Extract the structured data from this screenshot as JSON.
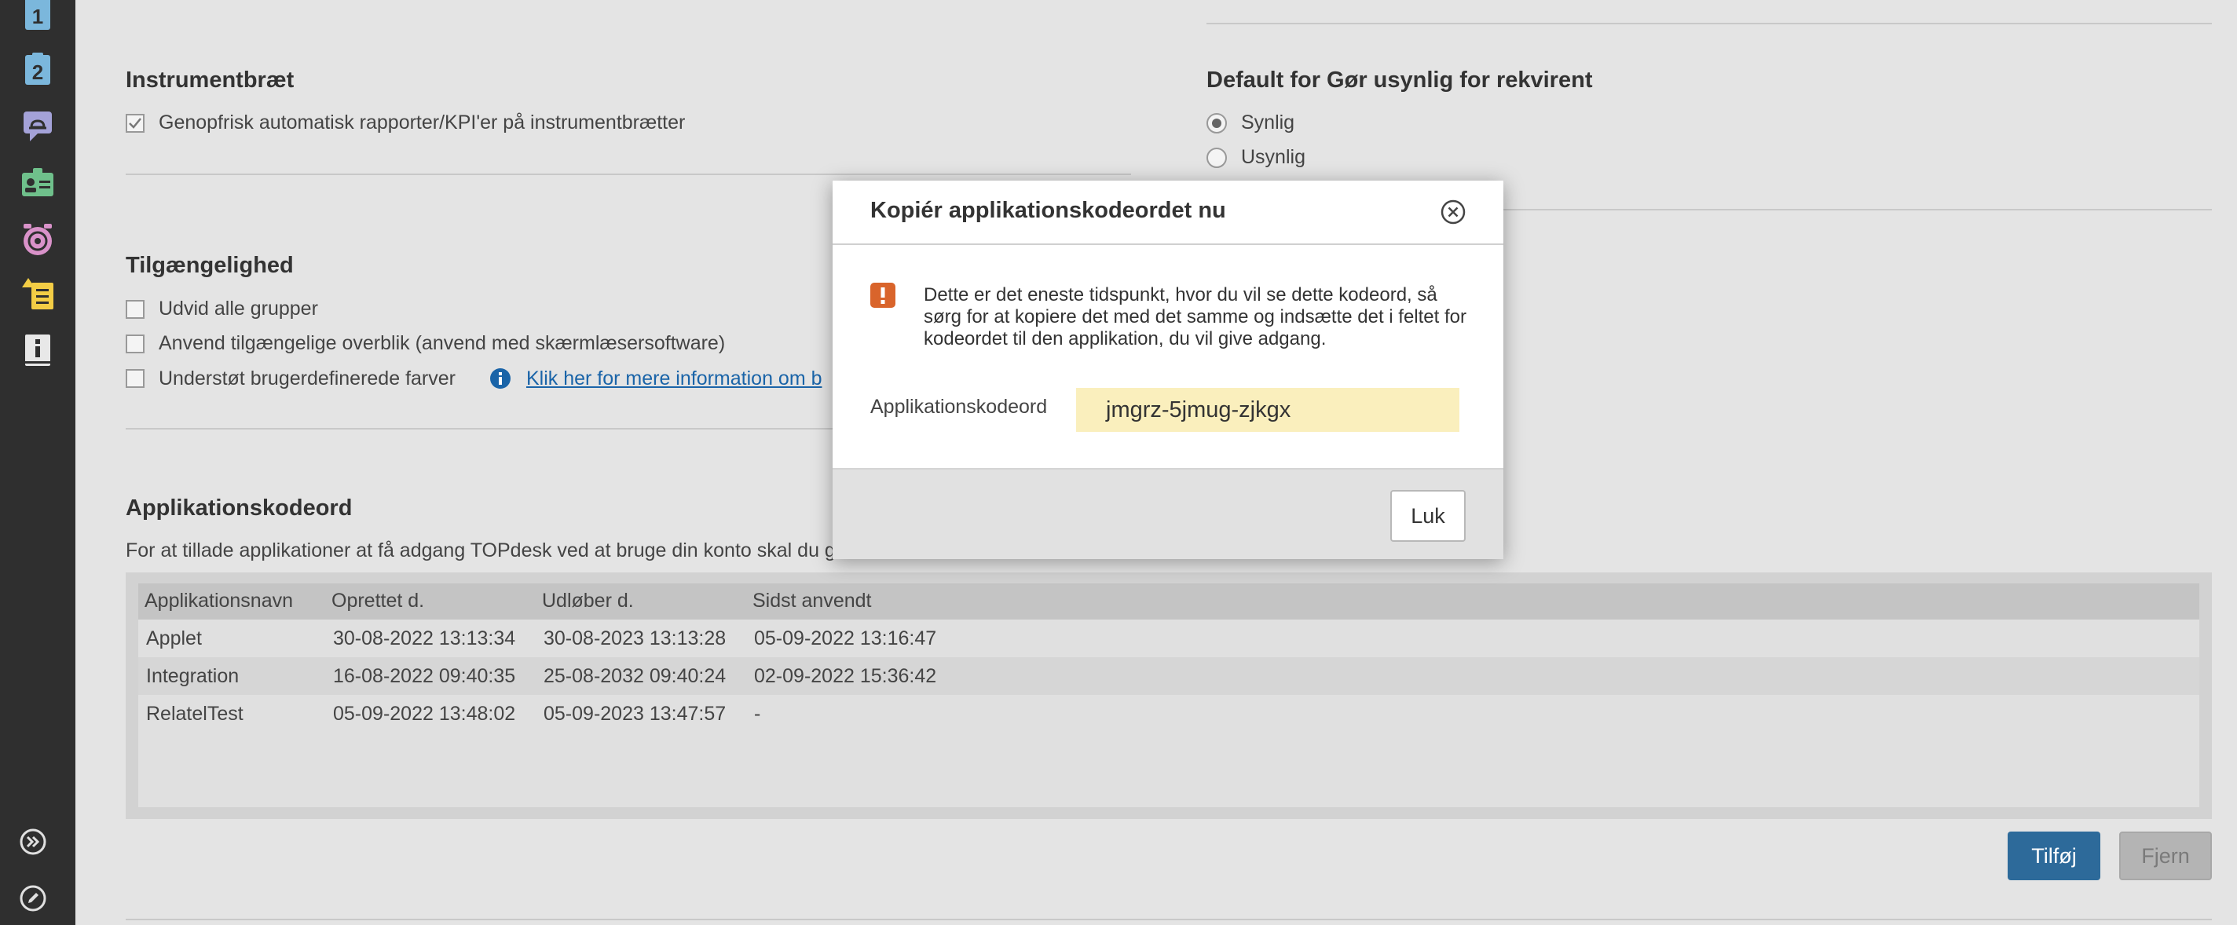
{
  "sidebar": {
    "items": [
      {
        "icon": "clipboard-1-icon",
        "label": "1",
        "color": "#7bb7dc"
      },
      {
        "icon": "clipboard-2-icon",
        "label": "2",
        "color": "#7bb7dc"
      },
      {
        "icon": "chat-cloud-icon",
        "color": "#a4a2d8"
      },
      {
        "icon": "contact-card-icon",
        "color": "#6fc08b"
      },
      {
        "icon": "alarm-clock-icon",
        "color": "#d992c9"
      },
      {
        "icon": "task-list-icon",
        "color": "#f3cd45"
      },
      {
        "icon": "info-book-icon",
        "color": "#e8e8e8"
      }
    ],
    "bottom": [
      {
        "icon": "expand-menu-icon"
      },
      {
        "icon": "edit-pencil-icon"
      }
    ]
  },
  "instrumentbraet": {
    "title": "Instrumentbræt",
    "auto_refresh_label": "Genopfrisk automatisk rapporter/KPI'er på instrumentbrætter",
    "auto_refresh_checked": true
  },
  "default_visibility": {
    "title": "Default for Gør usynlig for rekvirent",
    "options": [
      {
        "label": "Synlig",
        "selected": true
      },
      {
        "label": "Usynlig",
        "selected": false
      }
    ]
  },
  "tilgaengelighed": {
    "title": "Tilgængelighed",
    "options": [
      {
        "label": "Udvid alle grupper",
        "checked": false
      },
      {
        "label": "Anvend tilgængelige overblik (anvend med skærmlæsersoftware)",
        "checked": false
      },
      {
        "label": "Understøt brugerdefinerede farver",
        "checked": false
      }
    ],
    "info_link": "Klik her for mere information om b"
  },
  "app_passwords": {
    "title": "Applikationskodeord",
    "description": "For at tillade applikationer at få adgang TOPdesk ved at bruge din konto skal du g",
    "columns": [
      "Applikationsnavn",
      "Oprettet d.",
      "Udløber d.",
      "Sidst anvendt"
    ],
    "rows": [
      {
        "name": "Applet",
        "created": "30-08-2022 13:13:34",
        "expires": "30-08-2023 13:13:28",
        "last_used": "05-09-2022 13:16:47"
      },
      {
        "name": "Integration",
        "created": "16-08-2022 09:40:35",
        "expires": "25-08-2032 09:40:24",
        "last_used": "02-09-2022 15:36:42"
      },
      {
        "name": "RelatelTest",
        "created": "05-09-2022 13:48:02",
        "expires": "05-09-2023 13:47:57",
        "last_used": "-"
      }
    ],
    "add_button": "Tilføj",
    "remove_button": "Fjern"
  },
  "modal": {
    "title": "Kopiér applikationskodeordet nu",
    "message": "Dette er det eneste tidspunkt, hvor du vil se dette kodeord, så sørg for at kopiere det med det samme og indsætte det i feltet for kodeordet til den applikation, du vil give adgang.",
    "field_label": "Applikationskodeord",
    "field_value": "jmgrz-5jmug-zjkgx",
    "close_button": "Luk"
  },
  "colors": {
    "primary_button": "#2d6a9a",
    "warning": "#d9642b",
    "password_highlight": "#faefbd",
    "link": "#1a64a8"
  }
}
